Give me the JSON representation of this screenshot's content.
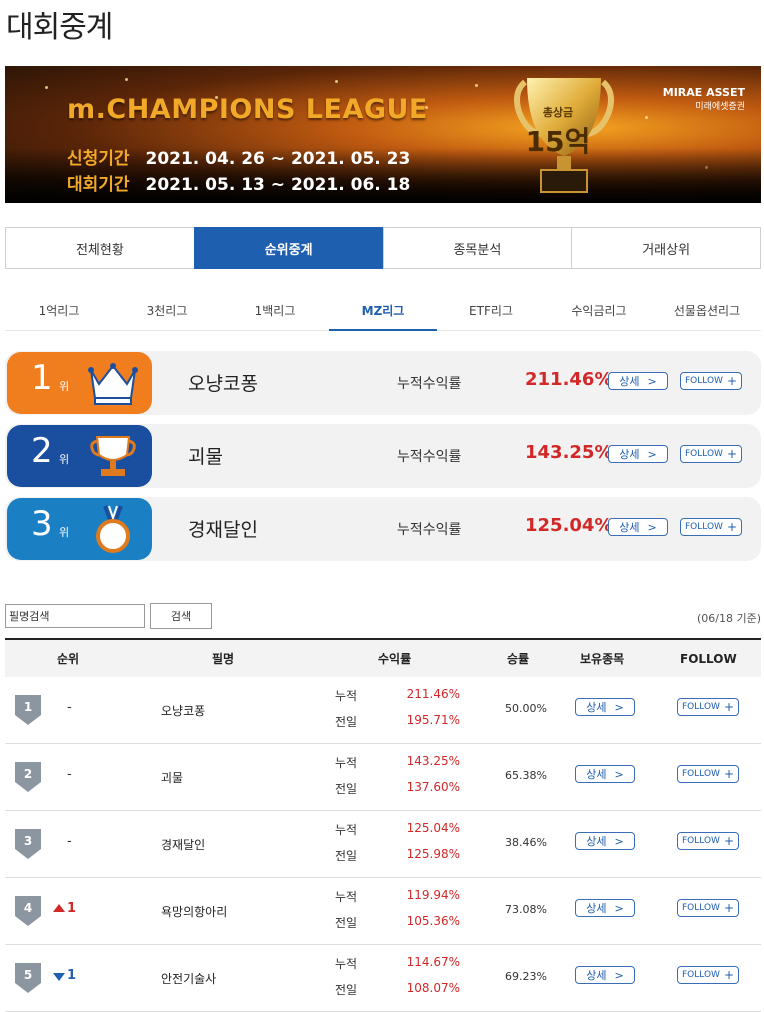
{
  "page": {
    "title": "대회중계"
  },
  "banner": {
    "title": "m.CHAMPIONS LEAGUE",
    "apply_label": "신청기간",
    "apply_period": "2021. 04. 26 ~ 2021. 05. 23",
    "contest_label": "대회기간",
    "contest_period": "2021. 05. 13 ~ 2021. 06. 18",
    "prize_small": "총상금",
    "prize_big": "15억",
    "brand": "MIRAE ASSET",
    "brand_sub": "미래에셋증권"
  },
  "main_tabs": [
    {
      "label": "전체현황"
    },
    {
      "label": "순위중계"
    },
    {
      "label": "종목분석"
    },
    {
      "label": "거래상위"
    }
  ],
  "sub_tabs": [
    {
      "label": "1억리그"
    },
    {
      "label": "3천리그"
    },
    {
      "label": "1백리그"
    },
    {
      "label": "MZ리그"
    },
    {
      "label": "ETF리그"
    },
    {
      "label": "수익금리그"
    },
    {
      "label": "선물옵션리그"
    }
  ],
  "top3": [
    {
      "rank": "1",
      "rank_suffix": "위",
      "name": "오냥코퐁",
      "label": "누적수익률",
      "pct": "211.46%",
      "detail": "상세",
      "follow": "FOLLOW",
      "color": "#f07d1e"
    },
    {
      "rank": "2",
      "rank_suffix": "위",
      "name": "괴물",
      "label": "누적수익률",
      "pct": "143.25%",
      "detail": "상세",
      "follow": "FOLLOW",
      "color": "#1a4fa0"
    },
    {
      "rank": "3",
      "rank_suffix": "위",
      "name": "경재달인",
      "label": "누적수익률",
      "pct": "125.04%",
      "detail": "상세",
      "follow": "FOLLOW",
      "color": "#1b7fc4"
    }
  ],
  "search": {
    "value": "필명검색",
    "button": "검색",
    "as_of": "(06/18 기준)"
  },
  "table": {
    "headers": {
      "rank": "순위",
      "name": "필명",
      "return": "수익률",
      "winrate": "승률",
      "holdings": "보유종목",
      "follow": "FOLLOW"
    },
    "rows": [
      {
        "rank": "1",
        "change": "-",
        "dir": "none",
        "name": "오냥코퐁",
        "lab1": "누적",
        "lab2": "전일",
        "cum": "211.46%",
        "prev": "195.71%",
        "winrate": "50.00%",
        "detail": "상세",
        "follow": "FOLLOW"
      },
      {
        "rank": "2",
        "change": "-",
        "dir": "none",
        "name": "괴물",
        "lab1": "누적",
        "lab2": "전일",
        "cum": "143.25%",
        "prev": "137.60%",
        "winrate": "65.38%",
        "detail": "상세",
        "follow": "FOLLOW"
      },
      {
        "rank": "3",
        "change": "-",
        "dir": "none",
        "name": "경재달인",
        "lab1": "누적",
        "lab2": "전일",
        "cum": "125.04%",
        "prev": "125.98%",
        "winrate": "38.46%",
        "detail": "상세",
        "follow": "FOLLOW"
      },
      {
        "rank": "4",
        "change": "1",
        "dir": "up",
        "name": "욕망의항아리",
        "lab1": "누적",
        "lab2": "전일",
        "cum": "119.94%",
        "prev": "105.36%",
        "winrate": "73.08%",
        "detail": "상세",
        "follow": "FOLLOW"
      },
      {
        "rank": "5",
        "change": "1",
        "dir": "down",
        "name": "안전기술사",
        "lab1": "누적",
        "lab2": "전일",
        "cum": "114.67%",
        "prev": "108.07%",
        "winrate": "69.23%",
        "detail": "상세",
        "follow": "FOLLOW"
      }
    ]
  },
  "colors": {
    "accent": "#1f5fb0",
    "red": "#d22828",
    "up": "#d22828",
    "down": "#1f5fb0"
  }
}
